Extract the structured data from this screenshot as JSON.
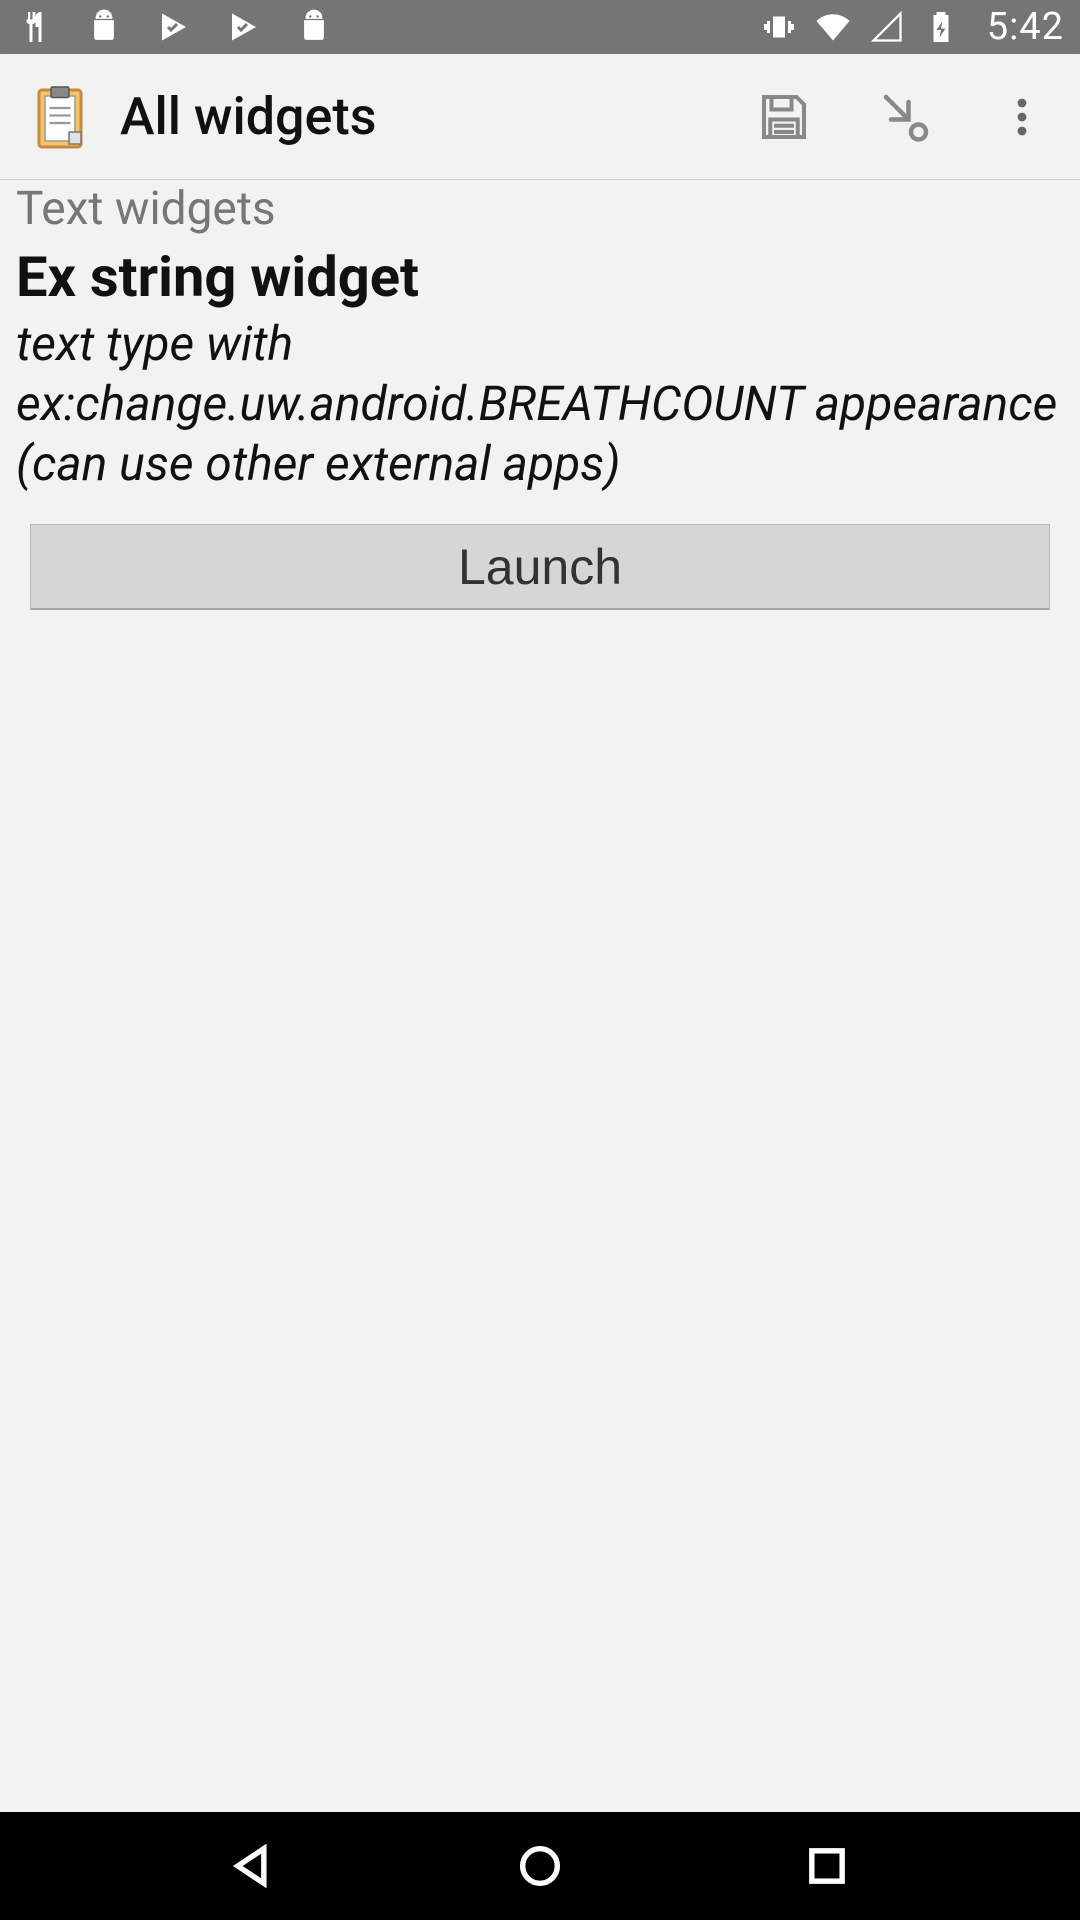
{
  "status_bar": {
    "time": "5:42"
  },
  "header": {
    "title": "All widgets"
  },
  "main": {
    "section_label": "Text widgets",
    "widget_title": "Ex string widget",
    "widget_desc": "text type with ex:change.uw.android.BREATHCOUNT appearance (can use other external apps)",
    "launch_label": "Launch"
  }
}
